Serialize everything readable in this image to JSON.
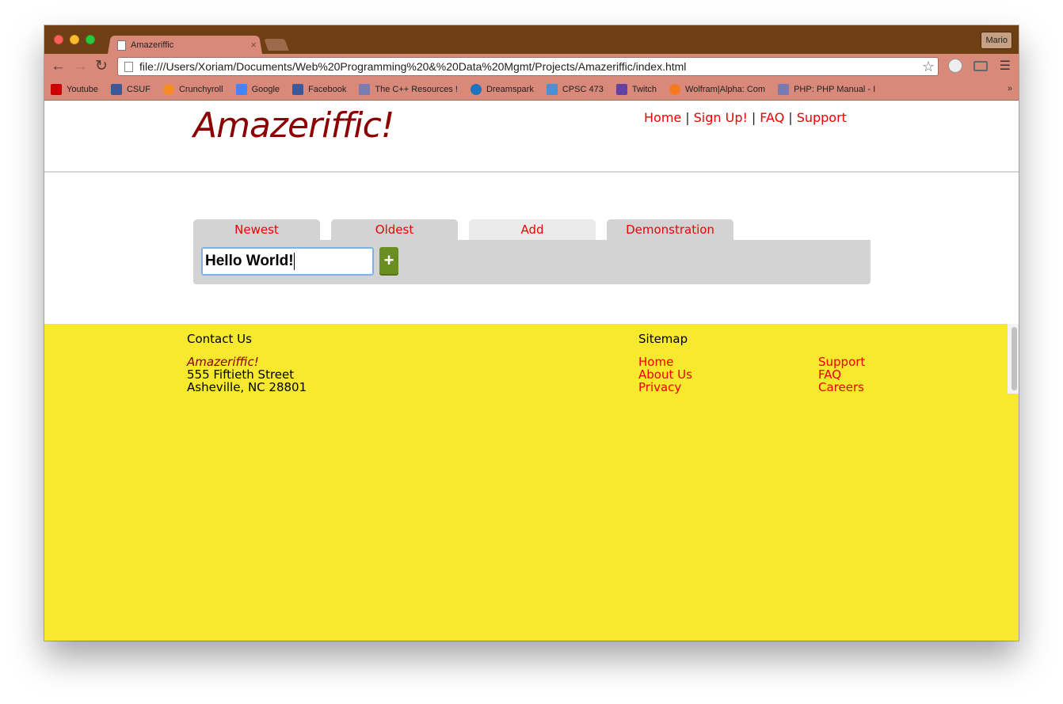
{
  "browser": {
    "tab_title": "Amazeriffic",
    "tab_close": "×",
    "profile_name": "Mario",
    "url": "file:///Users/Xoriam/Documents/Web%20Programming%20&%20Data%20Mgmt/Projects/Amazeriffic/index.html",
    "bookmarks": [
      {
        "label": "Youtube",
        "color": "#cc0000"
      },
      {
        "label": "CSUF",
        "color": "#3b5998"
      },
      {
        "label": "Crunchyroll",
        "color": "#f78c25"
      },
      {
        "label": "Google",
        "color": "#4285f4"
      },
      {
        "label": "Facebook",
        "color": "#3b5998"
      },
      {
        "label": "The C++ Resources !",
        "color": "#7b7bb3"
      },
      {
        "label": "Dreamspark",
        "color": "#1e73be"
      },
      {
        "label": "CPSC 473",
        "color": "#4a90d9"
      },
      {
        "label": "Twitch",
        "color": "#6441a5"
      },
      {
        "label": "Wolfram|Alpha: Com",
        "color": "#f57921"
      },
      {
        "label": "PHP: PHP Manual - I",
        "color": "#777bb3"
      }
    ],
    "bookmarks_more": "»"
  },
  "site": {
    "logo": "Amazeriffic!",
    "nav": [
      "Home",
      "Sign Up!",
      "FAQ",
      "Support"
    ],
    "nav_separator": "|"
  },
  "tabs": [
    {
      "label": "Newest",
      "active": false
    },
    {
      "label": "Oldest",
      "active": false
    },
    {
      "label": "Add",
      "active": true
    },
    {
      "label": "Demonstration",
      "active": false
    }
  ],
  "add_form": {
    "input_value": "Hello World!",
    "button_label": "+"
  },
  "footer": {
    "contact_heading": "Contact Us",
    "contact_name": "Amazeriffic!",
    "address_line1": "555 Fiftieth Street",
    "address_line2": "Asheville, NC 28801",
    "sitemap_heading": "Sitemap",
    "sitemap_col1": [
      "Home",
      "About Us",
      "Privacy"
    ],
    "sitemap_col2": [
      "Support",
      "FAQ",
      "Careers"
    ]
  },
  "colors": {
    "link": "#ee0000",
    "logo": "#8b0000",
    "footer_bg": "#f7e92e",
    "tab_bg": "#d3d3d3",
    "add_button": "#6b8e23"
  }
}
